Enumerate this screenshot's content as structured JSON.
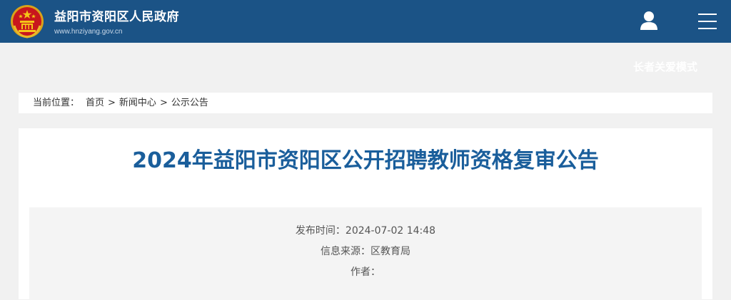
{
  "header": {
    "site_name": "益阳市资阳区人民政府",
    "site_url": "www.hnziyang.gov.cn",
    "brand_color": "#1b5386",
    "icons": {
      "emblem": "national-emblem-icon",
      "user": "user-icon",
      "menu": "menu-icon"
    }
  },
  "elder_mode": {
    "label": "长者关爱模式"
  },
  "breadcrumb": {
    "label": "当前位置：",
    "items": [
      "首页",
      "新闻中心",
      "公示公告"
    ],
    "separator": ">"
  },
  "article": {
    "title": "2024年益阳市资阳区公开招聘教师资格复审公告",
    "title_color": "#1a5e9b",
    "meta": {
      "publish_label": "发布时间：",
      "publish_time": "2024-07-02 14:48",
      "source_label": "信息来源：",
      "source": "区教育局",
      "author_label": "作者：",
      "author": ""
    }
  }
}
